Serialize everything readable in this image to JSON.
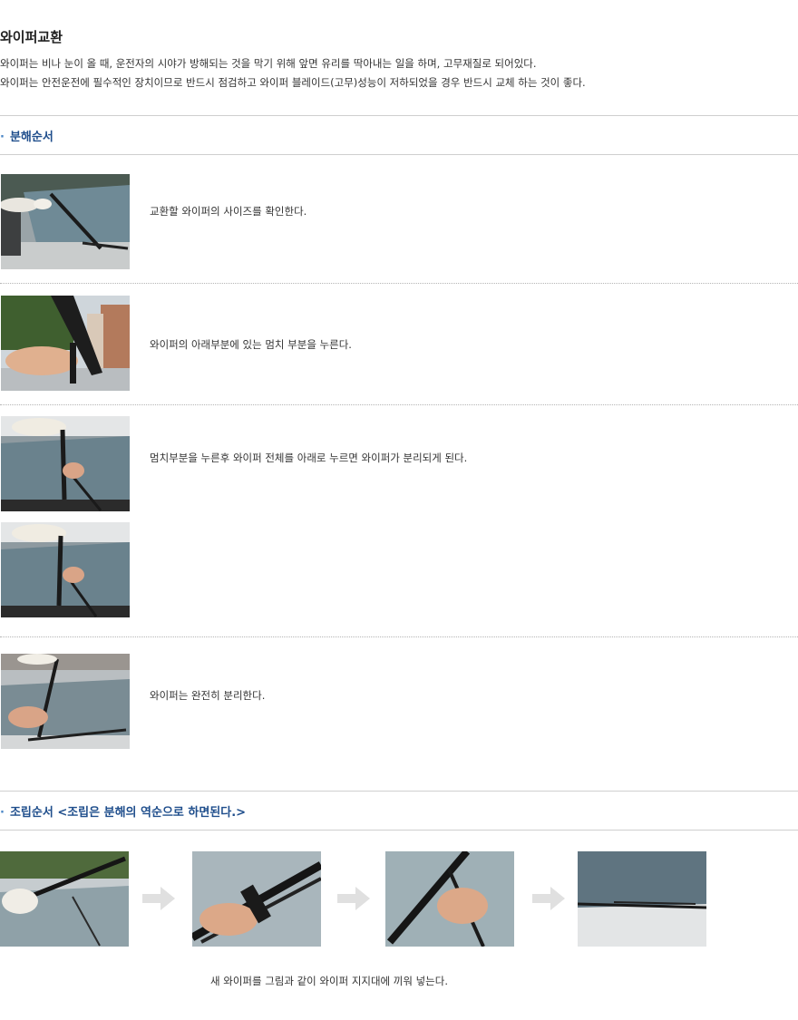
{
  "page": {
    "title": "와이퍼교환",
    "intro": [
      "와이퍼는 비나 눈이 올 때, 운전자의 시야가 방해되는 것을 막기 위해 앞면 유리를 딱아내는 일을 하며, 고무재질로 되어있다.",
      "와이퍼는 안전운전에 필수적인 장치이므로 반드시 점검하고 와이퍼 블레이드(고무)성능이 저하되었을 경우 반드시 교체 하는 것이 좋다."
    ]
  },
  "disassembly": {
    "heading": "분해순서",
    "steps": [
      {
        "caption": "교환할 와이퍼의 사이즈를 확인한다."
      },
      {
        "caption": "와이퍼의 아래부분에 있는 멈치 부분을 누른다."
      },
      {
        "caption": "멈치부분을 누른후 와이퍼 전체를 아래로 누르면 와이퍼가 분리되게 된다."
      },
      {
        "caption": "와이퍼는 완전히 분리한다."
      }
    ]
  },
  "assembly": {
    "heading": "조립순서 <조립은 분해의 역순으로 하면된다.>",
    "caption": "새 와이퍼를 그림과 같이 와이퍼 지지대에 끼워 넣는다."
  },
  "colors": {
    "heading": "#1f4e8c",
    "bullet": "#4a86c6",
    "text": "#333333"
  }
}
